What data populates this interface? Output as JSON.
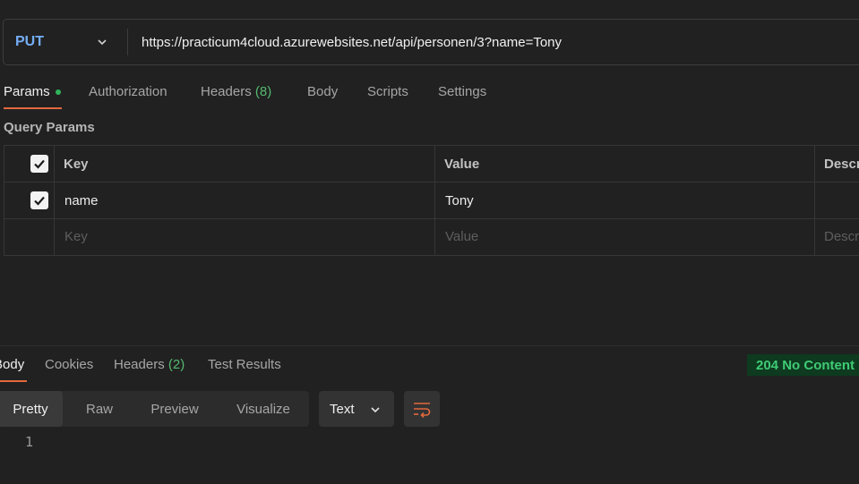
{
  "request": {
    "method": "PUT",
    "url": "https://practicum4cloud.azurewebsites.net/api/personen/3?name=Tony"
  },
  "request_tabs": {
    "params": "Params",
    "authorization": "Authorization",
    "headers": "Headers",
    "headers_count": "(8)",
    "body": "Body",
    "scripts": "Scripts",
    "settings": "Settings"
  },
  "query_params": {
    "title": "Query Params",
    "columns": {
      "key": "Key",
      "value": "Value",
      "description": "Descr"
    },
    "rows": [
      {
        "checked": true,
        "key": "name",
        "value": "Tony",
        "description": ""
      }
    ],
    "placeholders": {
      "key": "Key",
      "value": "Value",
      "description": "Descr"
    }
  },
  "response": {
    "tabs": {
      "body": "Body",
      "cookies": "Cookies",
      "headers": "Headers",
      "headers_count": "(2)",
      "test_results": "Test Results"
    },
    "status": "204 No Content",
    "view_modes": [
      "Pretty",
      "Raw",
      "Preview",
      "Visualize"
    ],
    "active_view": "Pretty",
    "format": "Text",
    "line_numbers": [
      "1"
    ]
  },
  "colors": {
    "method": "#74aef6",
    "accent_underline": "#e2693c",
    "status_text": "#3fcb75",
    "count_green": "#55b96f"
  },
  "icons": {
    "method_dropdown": "chevron-down-icon",
    "format_dropdown": "chevron-down-icon",
    "wrap": "wrap-lines-icon",
    "checkbox": "checkmark-icon"
  }
}
